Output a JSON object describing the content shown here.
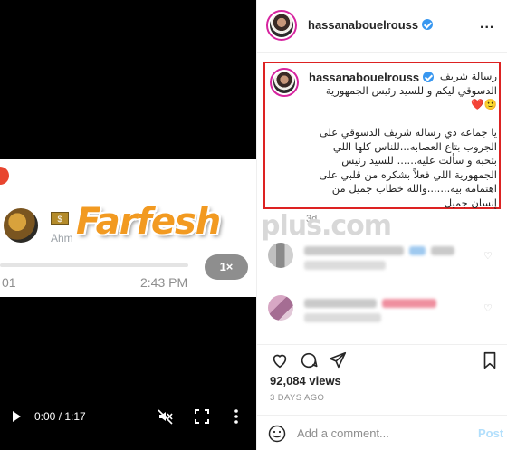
{
  "video": {
    "voice_note": {
      "sender": "Ahm",
      "badge": "$",
      "time_left": "01",
      "time_right": "2:43 PM",
      "speed": "1×",
      "progress_fraction": 0.0
    },
    "controls": {
      "time": "0:00 / 1:17",
      "play_icon": "play-icon",
      "mute_icon": "volume-muted-icon",
      "fullscreen_icon": "fullscreen-icon",
      "menu_icon": "more-vertical-icon"
    }
  },
  "watermark": {
    "brand": "Farfesh",
    "suffix": "plus.com",
    "color": "#f29a21"
  },
  "post": {
    "header": {
      "username": "hassanabouelrouss",
      "more": "..."
    },
    "caption": {
      "username": "hassanabouelrouss",
      "text": "رسالة شريف\nالدسوقي ليكم و للسيد رئيس الجمهورية\n🙂❤️\n\nيا جماعه دي رساله شريف الدسوقي على\nالجروب بتاع العصابه...للناس كلها اللي\nبتحبه و سألت عليه...... للسيد رئيس\nالجمهورية اللي فعلاً بشكره من قلبي على\nاهتمامه بيه.......والله خطاب جميل من\nإنسان جميل",
      "time": "3d"
    },
    "views": "92,084 views",
    "date": "3 DAYS AGO",
    "comment_box": {
      "placeholder": "Add a comment...",
      "post_label": "Post"
    },
    "colors": {
      "accent": "#3897f0",
      "post_button": "#b2dffc",
      "highlight_border": "#dd2222"
    }
  }
}
